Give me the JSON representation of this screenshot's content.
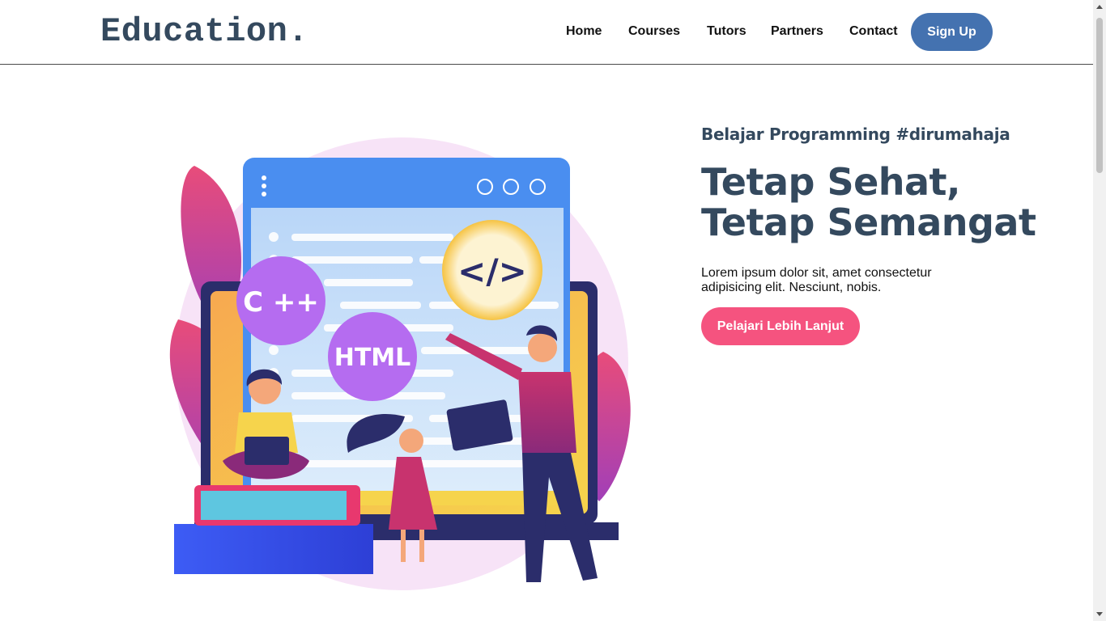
{
  "header": {
    "logo": "Education.",
    "nav": [
      "Home",
      "Courses",
      "Tutors",
      "Partners",
      "Contact"
    ],
    "signup_label": "Sign Up"
  },
  "hero": {
    "tagline": "Belajar Programming #dirumahaja",
    "headline_line1": "Tetap Sehat,",
    "headline_line2": "Tetap Semangat",
    "description": "Lorem ipsum dolor sit, amet consectetur adipisicing elit. Nesciunt, nobis.",
    "cta_label": "Pelajari Lebih Lanjut",
    "illustration": {
      "badge_cpp": "C ++",
      "badge_html": "HTML",
      "badge_code": "</>"
    }
  },
  "colors": {
    "brand": "#34495e",
    "signup": "#4472b0",
    "cta": "#f5537f"
  }
}
